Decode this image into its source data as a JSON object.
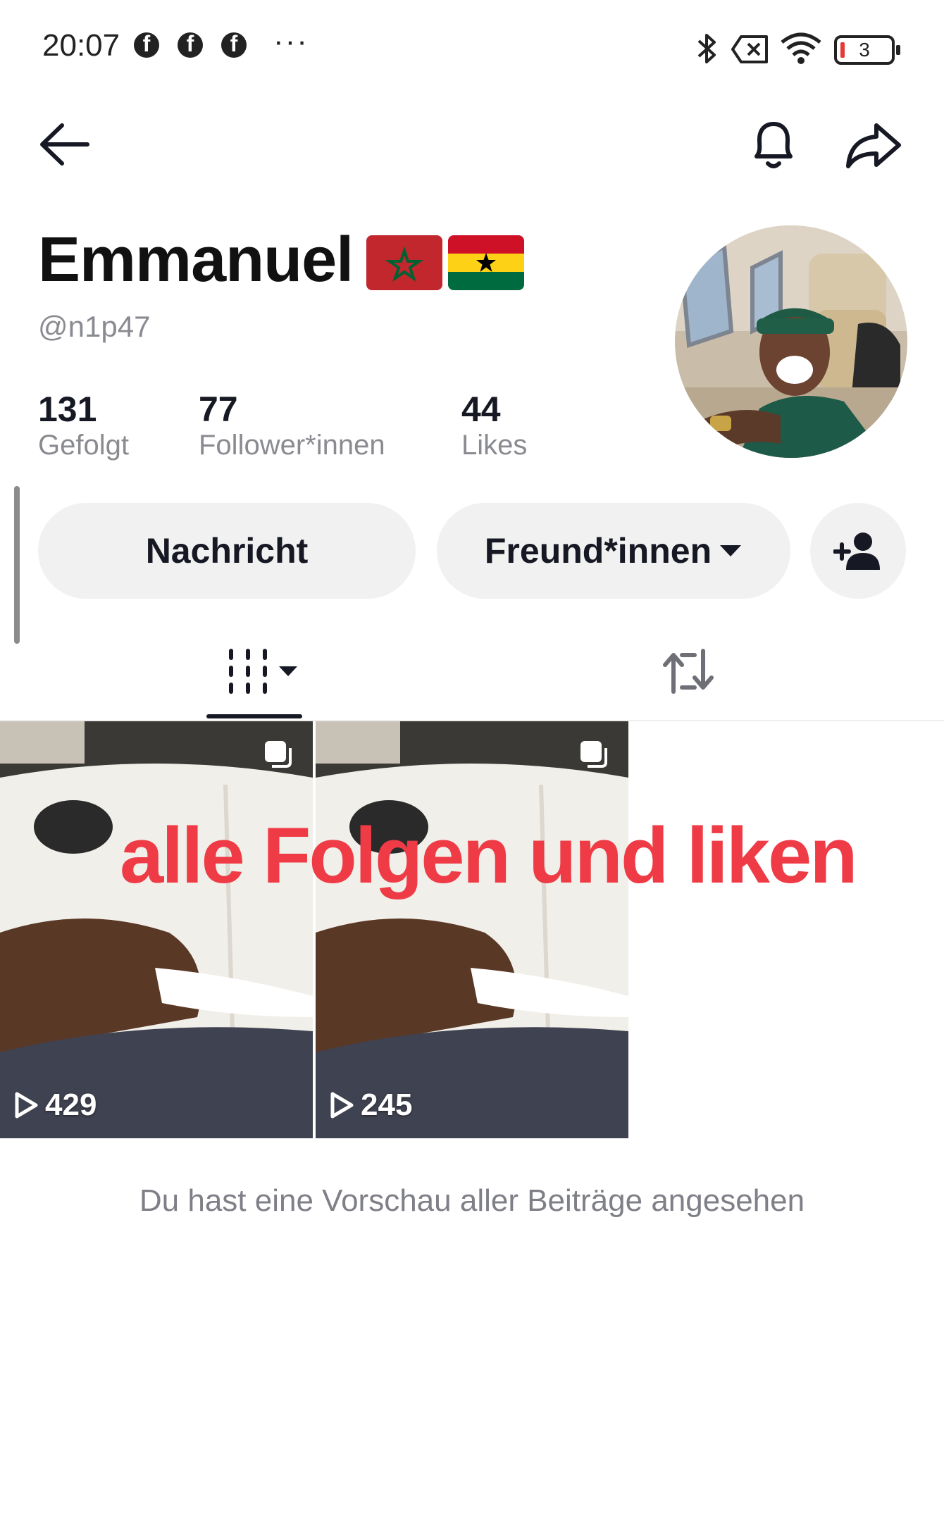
{
  "status_bar": {
    "time": "20:07",
    "app_icons": [
      "facebook-icon",
      "facebook-icon",
      "facebook-icon"
    ],
    "more": "···",
    "battery": "3"
  },
  "header": {
    "back_icon": "arrow-left-icon",
    "bell_icon": "bell-icon",
    "share_icon": "share-icon"
  },
  "profile": {
    "name": "Emmanuel",
    "flags": [
      "morocco-flag",
      "ghana-flag"
    ],
    "handle": "@n1p47",
    "stats": [
      {
        "value": "131",
        "label": "Gefolgt"
      },
      {
        "value": "77",
        "label": "Follower*innen"
      },
      {
        "value": "44",
        "label": "Likes"
      }
    ]
  },
  "actions": {
    "message_label": "Nachricht",
    "friends_label": "Freund*innen",
    "add_friend_icon": "add-user-icon"
  },
  "tabs": {
    "videos_icon": "grid-icon",
    "reposts_icon": "repost-icon"
  },
  "posts": [
    {
      "views": "429"
    },
    {
      "views": "245"
    }
  ],
  "overlay_text": "alle Folgen und liken",
  "footer_note": "Du hast eine Vorschau aller Beiträge angesehen",
  "colors": {
    "accent_red": "#ef3b45",
    "button_bg": "#f1f1f2",
    "secondary_text": "#8a8b91"
  }
}
